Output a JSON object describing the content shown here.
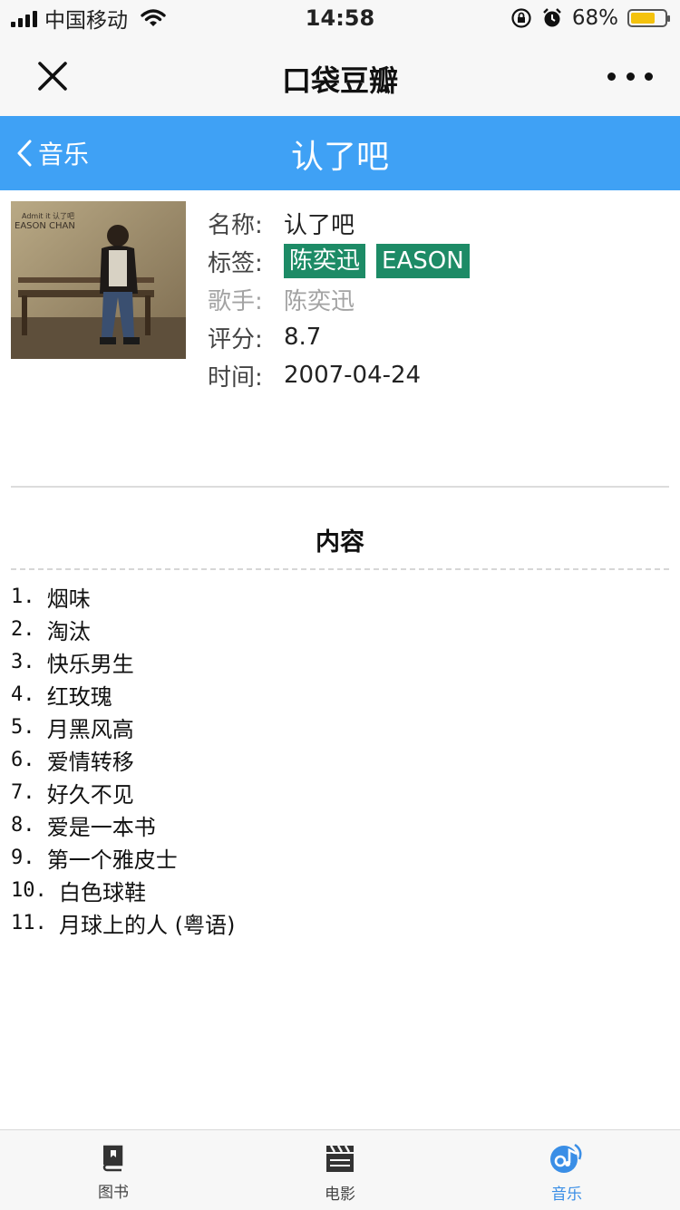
{
  "status_bar": {
    "carrier": "中国移动",
    "time": "14:58",
    "battery": "68%",
    "battery_level": 0.68
  },
  "wechat_nav": {
    "title": "口袋豆瓣"
  },
  "header": {
    "back_label": "音乐",
    "title": "认了吧"
  },
  "album": {
    "name_label": "名称:",
    "name": "认了吧",
    "tags_label": "标签:",
    "tags": [
      "陈奕迅",
      "EASON"
    ],
    "artist_label": "歌手:",
    "artist": "陈奕迅",
    "rating_label": "评分:",
    "rating": "8.7",
    "date_label": "时间:",
    "date": "2007-04-24",
    "cover_text": {
      "line1": "Admit it 认了吧",
      "line2": "EASON CHAN"
    }
  },
  "contents": {
    "title": "内容",
    "tracks": [
      {
        "num": "1. ",
        "title": "烟味"
      },
      {
        "num": "2. ",
        "title": "淘汰"
      },
      {
        "num": "3. ",
        "title": "快乐男生"
      },
      {
        "num": "4. ",
        "title": "红玫瑰"
      },
      {
        "num": "5. ",
        "title": "月黑风高"
      },
      {
        "num": "6. ",
        "title": "爱情转移"
      },
      {
        "num": "7. ",
        "title": "好久不见"
      },
      {
        "num": "8. ",
        "title": "爱是一本书"
      },
      {
        "num": "9. ",
        "title": "第一个雅皮士"
      },
      {
        "num": "10. ",
        "title": "白色球鞋"
      },
      {
        "num": "11. ",
        "title": "月球上的人 (粤语)"
      }
    ]
  },
  "tabbar": {
    "items": [
      {
        "label": "图书",
        "icon": "book-icon"
      },
      {
        "label": "电影",
        "icon": "clapperboard-icon"
      },
      {
        "label": "音乐",
        "icon": "music-disc-icon",
        "active": true
      }
    ]
  },
  "colors": {
    "header_bg": "#3fa1f5",
    "tag_bg": "#1d8b66",
    "active_tab": "#3a8ee6"
  }
}
